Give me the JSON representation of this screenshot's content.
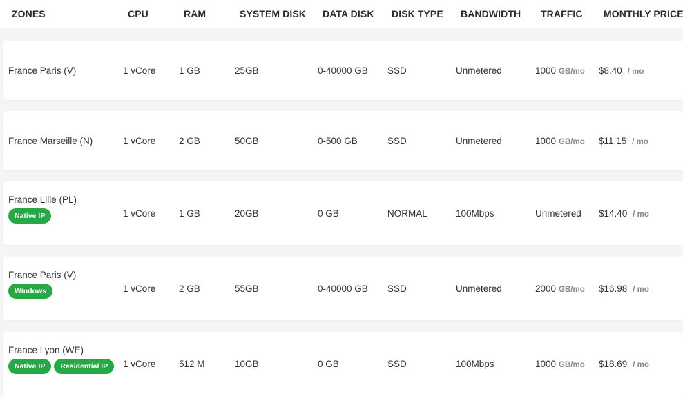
{
  "headers": [
    "ZONES",
    "CPU",
    "RAM",
    "SYSTEM DISK",
    "DATA DISK",
    "DISK TYPE",
    "BANDWIDTH",
    "TRAFFIC",
    "MONTHLY PRICE"
  ],
  "rows": [
    {
      "zone": "France Paris (V)",
      "badges": [],
      "cpu": "1 vCore",
      "ram": "1 GB",
      "system_disk": "25GB",
      "data_disk": "0-40000 GB",
      "disk_type": "SSD",
      "bandwidth": "Unmetered",
      "traffic": "1000",
      "traffic_unit": "GB/mo",
      "price": "$8.40",
      "price_unit": "/ mo"
    },
    {
      "zone": "France Marseille (N)",
      "badges": [],
      "cpu": "1 vCore",
      "ram": "2 GB",
      "system_disk": "50GB",
      "data_disk": "0-500 GB",
      "disk_type": "SSD",
      "bandwidth": "Unmetered",
      "traffic": "1000",
      "traffic_unit": "GB/mo",
      "price": "$11.15",
      "price_unit": "/ mo"
    },
    {
      "zone": "France Lille (PL)",
      "badges": [
        "Native IP"
      ],
      "cpu": "1 vCore",
      "ram": "1 GB",
      "system_disk": "20GB",
      "data_disk": "0 GB",
      "disk_type": "NORMAL",
      "bandwidth": "100Mbps",
      "traffic": "Unmetered",
      "traffic_unit": "",
      "price": "$14.40",
      "price_unit": "/ mo"
    },
    {
      "zone": "France Paris (V)",
      "badges": [
        "Windows"
      ],
      "cpu": "1 vCore",
      "ram": "2 GB",
      "system_disk": "55GB",
      "data_disk": "0-40000 GB",
      "disk_type": "SSD",
      "bandwidth": "Unmetered",
      "traffic": "2000",
      "traffic_unit": "GB/mo",
      "price": "$16.98",
      "price_unit": "/ mo"
    },
    {
      "zone": "France Lyon (WE)",
      "badges": [
        "Native IP",
        "Residential IP"
      ],
      "cpu": "1 vCore",
      "ram": "512 M",
      "system_disk": "10GB",
      "data_disk": "0 GB",
      "disk_type": "SSD",
      "bandwidth": "100Mbps",
      "traffic": "1000",
      "traffic_unit": "GB/mo",
      "price": "$18.69",
      "price_unit": "/ mo"
    }
  ],
  "colors": {
    "badge": "#28a745",
    "page_bg": "#f4f5f7",
    "row_bg": "#ffffff",
    "muted_unit": "#8a8a8a"
  }
}
